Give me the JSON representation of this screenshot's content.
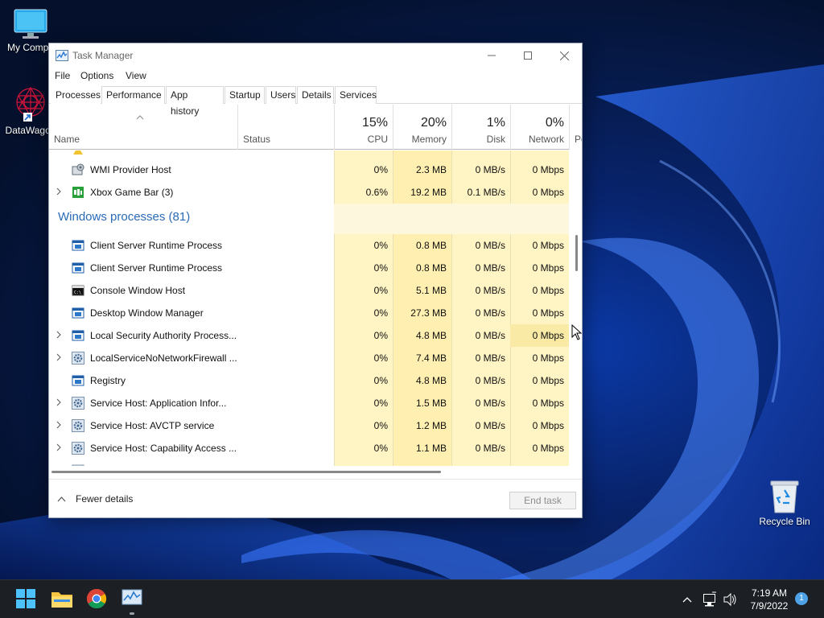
{
  "desktop": {
    "icons": [
      {
        "label": "My Compu",
        "icon": "computer-icon"
      },
      {
        "label": "DataWagon",
        "icon": "datawagon-shortcut-icon"
      },
      {
        "label": "Recycle Bin",
        "icon": "recycle-bin-icon"
      }
    ]
  },
  "window": {
    "title": "Task Manager",
    "menu": [
      "File",
      "Options",
      "View"
    ],
    "tabs": [
      "Processes",
      "Performance",
      "App history",
      "Startup",
      "Users",
      "Details",
      "Services"
    ],
    "active_tab": "Processes",
    "columns": {
      "name": "Name",
      "status": "Status",
      "cpu": {
        "pct": "15%",
        "label": "CPU"
      },
      "memory": {
        "pct": "20%",
        "label": "Memory"
      },
      "disk": {
        "pct": "1%",
        "label": "Disk"
      },
      "network": {
        "pct": "0%",
        "label": "Network"
      },
      "power": "Po"
    },
    "rows": [
      {
        "name": "WMI Provider Host",
        "expandable": false,
        "icon": "wmi-icon",
        "cpu": "0%",
        "memory": "2.3 MB",
        "disk": "0 MB/s",
        "network": "0 Mbps"
      },
      {
        "name": "Xbox Game Bar (3)",
        "expandable": true,
        "icon": "xbox-game-bar-icon",
        "cpu": "0.6%",
        "memory": "19.2 MB",
        "disk": "0.1 MB/s",
        "network": "0 Mbps"
      }
    ],
    "group_title": "Windows processes (81)",
    "windows_processes": [
      {
        "name": "Client Server Runtime Process",
        "expandable": false,
        "icon": "process-window-icon",
        "cpu": "0%",
        "memory": "0.8 MB",
        "disk": "0 MB/s",
        "network": "0 Mbps"
      },
      {
        "name": "Client Server Runtime Process",
        "expandable": false,
        "icon": "process-window-icon",
        "cpu": "0%",
        "memory": "0.8 MB",
        "disk": "0 MB/s",
        "network": "0 Mbps"
      },
      {
        "name": "Console Window Host",
        "expandable": false,
        "icon": "console-icon",
        "cpu": "0%",
        "memory": "5.1 MB",
        "disk": "0 MB/s",
        "network": "0 Mbps"
      },
      {
        "name": "Desktop Window Manager",
        "expandable": false,
        "icon": "process-window-icon",
        "cpu": "0%",
        "memory": "27.3 MB",
        "disk": "0 MB/s",
        "network": "0 Mbps"
      },
      {
        "name": "Local Security Authority Process...",
        "expandable": true,
        "icon": "process-window-icon",
        "cpu": "0%",
        "memory": "4.8 MB",
        "disk": "0 MB/s",
        "network": "0 Mbps"
      },
      {
        "name": "LocalServiceNoNetworkFirewall ...",
        "expandable": true,
        "icon": "service-gear-icon",
        "cpu": "0%",
        "memory": "7.4 MB",
        "disk": "0 MB/s",
        "network": "0 Mbps"
      },
      {
        "name": "Registry",
        "expandable": false,
        "icon": "process-window-icon",
        "cpu": "0%",
        "memory": "4.8 MB",
        "disk": "0 MB/s",
        "network": "0 Mbps"
      },
      {
        "name": "Service Host: Application Infor...",
        "expandable": true,
        "icon": "service-gear-icon",
        "cpu": "0%",
        "memory": "1.5 MB",
        "disk": "0 MB/s",
        "network": "0 Mbps"
      },
      {
        "name": "Service Host: AVCTP service",
        "expandable": true,
        "icon": "service-gear-icon",
        "cpu": "0%",
        "memory": "1.2 MB",
        "disk": "0 MB/s",
        "network": "0 Mbps"
      },
      {
        "name": "Service Host: Capability Access ...",
        "expandable": true,
        "icon": "service-gear-icon",
        "cpu": "0%",
        "memory": "1.1 MB",
        "disk": "0 MB/s",
        "network": "0 Mbps"
      }
    ],
    "footer": {
      "fewer_details": "Fewer details",
      "end_task": "End task"
    }
  },
  "taskbar": {
    "apps": [
      "start-icon",
      "file-explorer-icon",
      "chrome-icon",
      "task-manager-icon"
    ],
    "time": "7:19 AM",
    "date": "7/9/2022",
    "notifications": "1"
  },
  "colors": {
    "heat_light": "#fff4c4",
    "heat_medium": "#ffefb0",
    "heat_hover": "#f9eaa6",
    "group_title": "#2a6bb6"
  }
}
